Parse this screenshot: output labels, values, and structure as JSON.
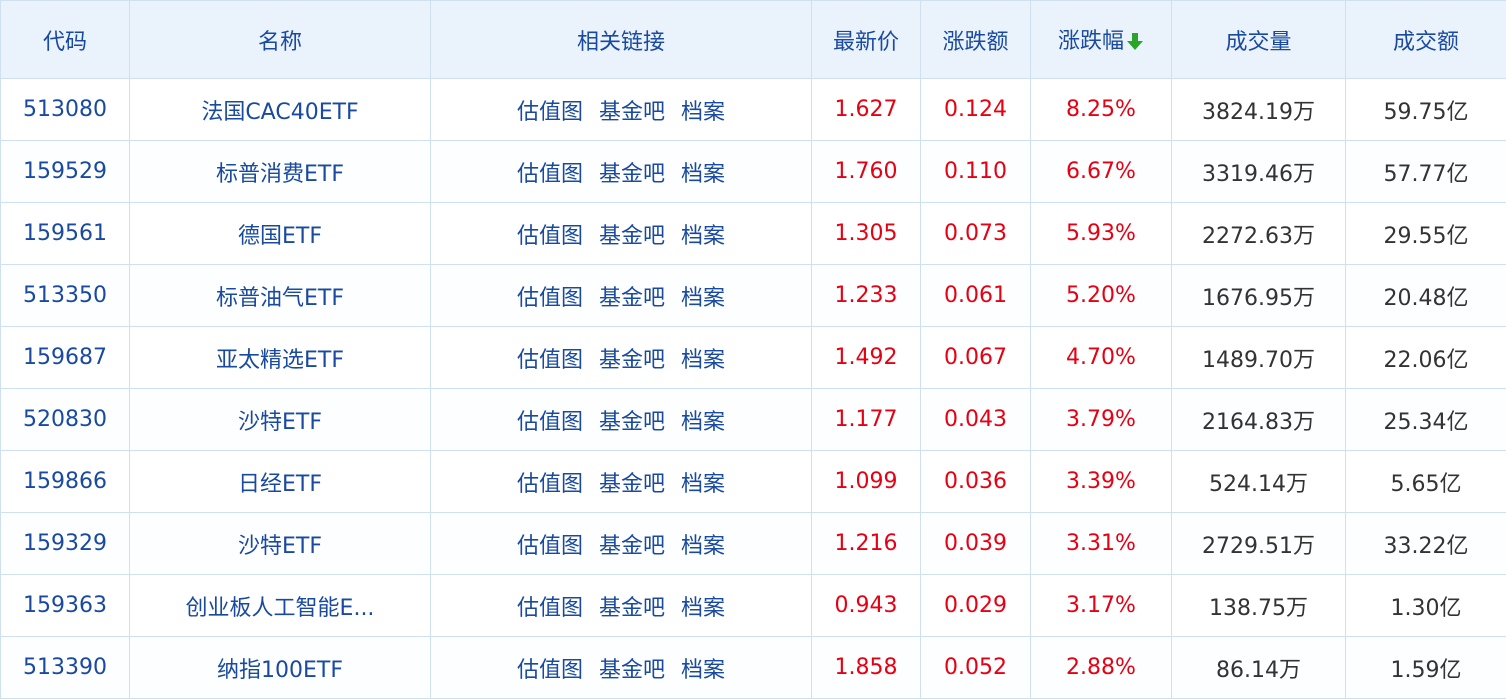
{
  "colors": {
    "accent": "#1a4aa0",
    "up": "#e60012",
    "sort_arrow": "#2aa52a"
  },
  "headers": {
    "code": "代码",
    "name": "名称",
    "links": "相关链接",
    "price": "最新价",
    "change": "涨跌额",
    "change_pct": "涨跌幅",
    "volume": "成交量",
    "amount": "成交额"
  },
  "sort_icon": "arrow-down-icon",
  "link_labels": [
    "估值图",
    "基金吧",
    "档案"
  ],
  "rows": [
    {
      "code": "513080",
      "name": "法国CAC40ETF",
      "price": "1.627",
      "change": "0.124",
      "change_pct": "8.25%",
      "volume": "3824.19万",
      "amount": "59.75亿"
    },
    {
      "code": "159529",
      "name": "标普消费ETF",
      "price": "1.760",
      "change": "0.110",
      "change_pct": "6.67%",
      "volume": "3319.46万",
      "amount": "57.77亿"
    },
    {
      "code": "159561",
      "name": "德国ETF",
      "price": "1.305",
      "change": "0.073",
      "change_pct": "5.93%",
      "volume": "2272.63万",
      "amount": "29.55亿"
    },
    {
      "code": "513350",
      "name": "标普油气ETF",
      "price": "1.233",
      "change": "0.061",
      "change_pct": "5.20%",
      "volume": "1676.95万",
      "amount": "20.48亿"
    },
    {
      "code": "159687",
      "name": "亚太精选ETF",
      "price": "1.492",
      "change": "0.067",
      "change_pct": "4.70%",
      "volume": "1489.70万",
      "amount": "22.06亿"
    },
    {
      "code": "520830",
      "name": "沙特ETF",
      "price": "1.177",
      "change": "0.043",
      "change_pct": "3.79%",
      "volume": "2164.83万",
      "amount": "25.34亿"
    },
    {
      "code": "159866",
      "name": "日经ETF",
      "price": "1.099",
      "change": "0.036",
      "change_pct": "3.39%",
      "volume": "524.14万",
      "amount": "5.65亿"
    },
    {
      "code": "159329",
      "name": "沙特ETF",
      "price": "1.216",
      "change": "0.039",
      "change_pct": "3.31%",
      "volume": "2729.51万",
      "amount": "33.22亿"
    },
    {
      "code": "159363",
      "name": "创业板人工智能E...",
      "price": "0.943",
      "change": "0.029",
      "change_pct": "3.17%",
      "volume": "138.75万",
      "amount": "1.30亿"
    },
    {
      "code": "513390",
      "name": "纳指100ETF",
      "price": "1.858",
      "change": "0.052",
      "change_pct": "2.88%",
      "volume": "86.14万",
      "amount": "1.59亿"
    }
  ]
}
